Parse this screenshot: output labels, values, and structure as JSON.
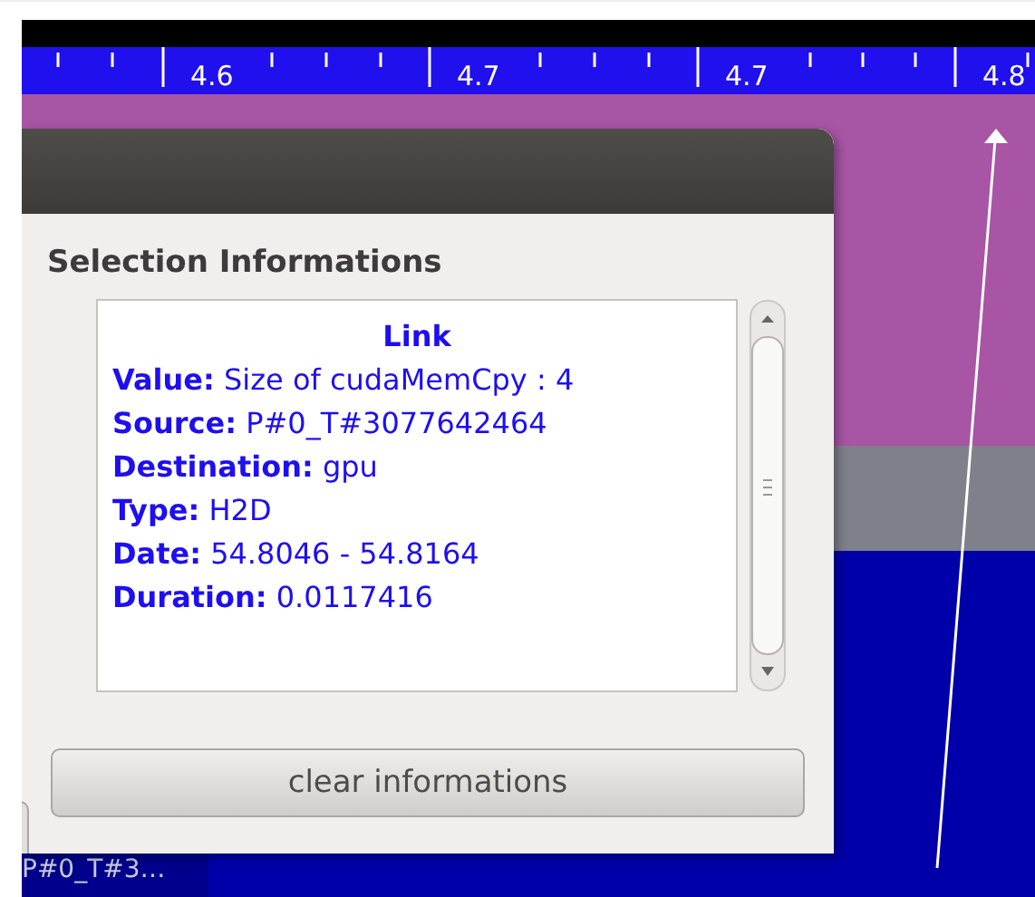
{
  "ruler": {
    "labels": [
      "4.6",
      "4.7",
      "4.7",
      "4.8"
    ]
  },
  "dialog": {
    "section_label": "Selection Informations",
    "info": {
      "heading": "Link",
      "lines": [
        "**Value:** Size of cudaMemCpy : 4",
        "**Source:** P#0_T#3077642464",
        "**Destination:** gpu",
        "**Type:** H2D",
        "**Date:** 54.8046 - 54.8164",
        "**Duration:** 0.0117416"
      ]
    },
    "button": "clear informations"
  },
  "timeline": {
    "row_label": "P#0_T#3…"
  }
}
